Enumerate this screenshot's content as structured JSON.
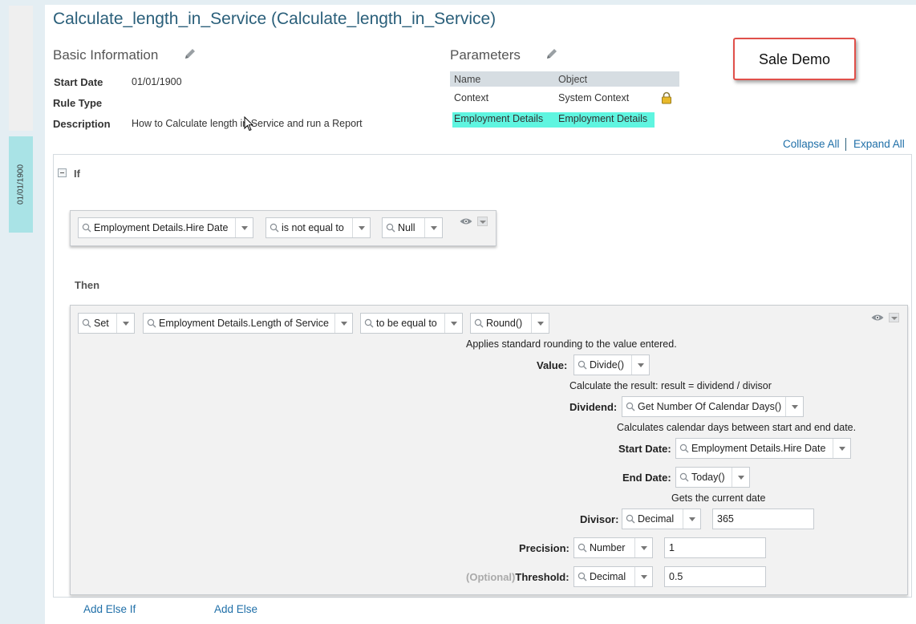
{
  "rail": {
    "date": "01/01/1900"
  },
  "page": {
    "title": "Calculate_length_in_Service (Calculate_length_in_Service)"
  },
  "basic": {
    "title": "Basic Information",
    "start_date_label": "Start Date",
    "start_date": "01/01/1900",
    "rule_type_label": "Rule Type",
    "rule_type": "",
    "description_label": "Description",
    "description": "How to Calculate length in Service and run a Report"
  },
  "parameters": {
    "title": "Parameters",
    "col_name": "Name",
    "col_object": "Object",
    "rows": [
      {
        "name": "Context",
        "object": "System Context"
      },
      {
        "name": "Employment Details",
        "object": "Employment Details"
      }
    ]
  },
  "callout": "Sale Demo",
  "actions": {
    "collapse_all": "Collapse All",
    "expand_all": "Expand All"
  },
  "if_block": {
    "keyword": "If",
    "field": "Employment Details.Hire Date",
    "operator": "is not equal to",
    "value": "Null"
  },
  "then_block": {
    "keyword": "Then",
    "action": "Set",
    "target": "Employment Details.Length of Service",
    "operator": "to be equal to",
    "function": "Round()",
    "function_desc": "Applies standard rounding to the value entered.",
    "value_label": "Value:",
    "value_fn": "Divide()",
    "value_desc": "Calculate the result: result = dividend / divisor",
    "dividend_label": "Dividend:",
    "dividend_fn": "Get Number Of Calendar Days()",
    "dividend_desc": "Calculates calendar days between start and end date.",
    "start_date_label": "Start Date:",
    "start_date_value": "Employment Details.Hire Date",
    "end_date_label": "End Date:",
    "end_date_value": "Today()",
    "end_date_desc": "Gets the current date",
    "divisor_label": "Divisor:",
    "divisor_type": "Decimal",
    "divisor_value": "365",
    "precision_label": "Precision:",
    "precision_type": "Number",
    "precision_value": "1",
    "threshold_optional": "(Optional)",
    "threshold_label": "Threshold:",
    "threshold_type": "Decimal",
    "threshold_value": "0.5"
  },
  "footer": {
    "add_else_if": "Add Else If",
    "add_else": "Add Else"
  }
}
